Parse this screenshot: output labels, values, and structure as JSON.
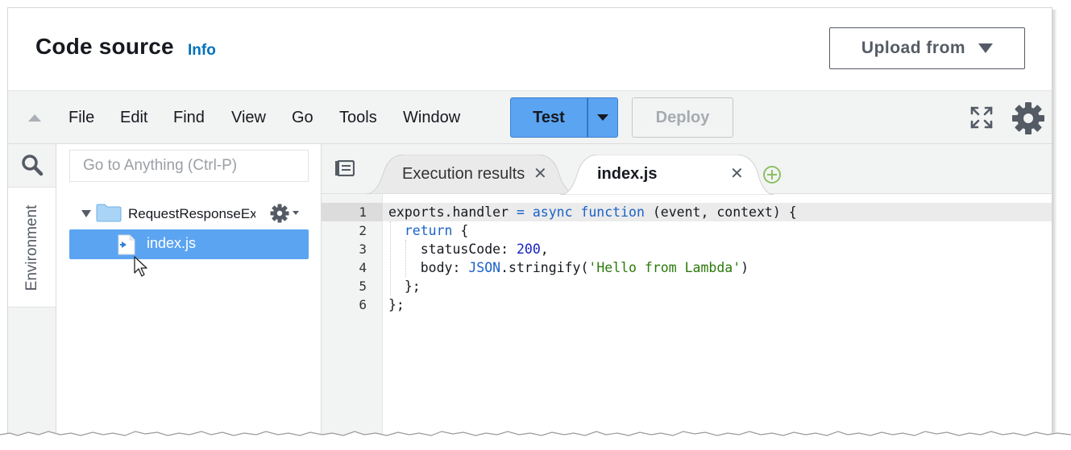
{
  "header": {
    "title": "Code source",
    "info_link": "Info",
    "upload_button": "Upload from"
  },
  "menubar": {
    "items": [
      "File",
      "Edit",
      "Find",
      "View",
      "Go",
      "Tools",
      "Window"
    ],
    "test_button": "Test",
    "deploy_button": "Deploy"
  },
  "sidebar": {
    "environment_tab": "Environment",
    "search_placeholder": "Go to Anything (Ctrl-P)",
    "folder_name": "RequestResponseEx",
    "selected_file": "index.js"
  },
  "editor": {
    "tabs": [
      {
        "label": "Execution results",
        "active": false
      },
      {
        "label": "index.js",
        "active": true
      }
    ],
    "line_numbers": [
      "1",
      "2",
      "3",
      "4",
      "5",
      "6"
    ],
    "code": {
      "l1_a": "exports.handler ",
      "l1_eq": "=",
      "l1_async": "async",
      "l1_function": "function",
      "l1_b": " (event, context) {",
      "l2_return": "return",
      "l2_b": " {",
      "l3_a": "statusCode: ",
      "l3_num": "200",
      "l3_b": ",",
      "l4_a": "body: ",
      "l4_json": "JSON",
      "l4_b": ".stringify(",
      "l4_str": "'Hello from Lambda'",
      "l4_c": ")",
      "l5": "};",
      "l6": "};"
    }
  },
  "colors": {
    "accent_blue": "#5ba4f2",
    "link_blue": "#0073bb",
    "keyword": "#1a62c9",
    "string": "#2b7a0b",
    "number": "#1722c4"
  },
  "icons": [
    "collapse-up-icon",
    "fullscreen-icon",
    "gear-icon",
    "search-icon",
    "folder-icon",
    "file-js-icon",
    "tab-list-icon",
    "close-icon",
    "add-tab-icon",
    "mouse-cursor-icon"
  ]
}
